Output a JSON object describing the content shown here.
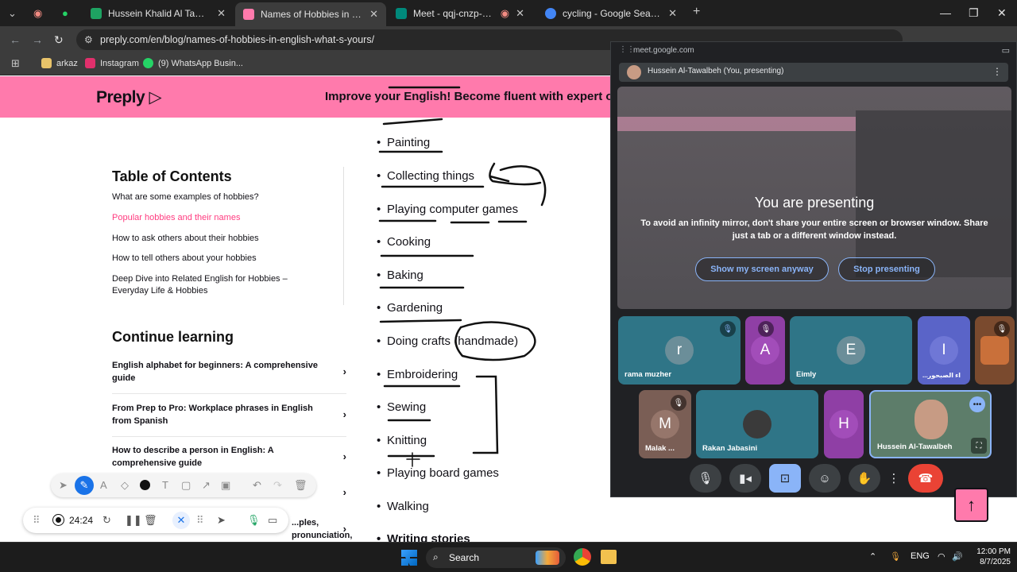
{
  "browser": {
    "tabs": [
      {
        "title": "Hussein Khalid Al Tawalbeh - Gc",
        "color": "#1ea362"
      },
      {
        "title": "Names of Hobbies in English: U",
        "color": "#ff7aac",
        "active": true
      },
      {
        "title": "Meet - qqj-cnzp-pcz",
        "color": "#00897b"
      },
      {
        "title": "cycling - Google Search",
        "color": "#4285f4"
      }
    ],
    "new_tab": "+",
    "url": "preply.com/en/blog/names-of-hobbies-in-english-what-s-yours/",
    "bookmarks": [
      {
        "label": "arkaz",
        "color": "#e8c36a"
      },
      {
        "label": "Instagram",
        "color": "#e1306c"
      },
      {
        "label": "(9) WhatsApp Busin...",
        "color": "#25d366"
      }
    ]
  },
  "page": {
    "logo": "Preply",
    "banner": "Improve your English! Become fluent with expert onli",
    "toc": {
      "title": "Table of Contents",
      "items": [
        "What are some examples of hobbies?",
        "Popular hobbies and their names",
        "How to ask others about their hobbies",
        "How to tell others about your hobbies",
        "Deep Dive into Related English for Hobbies – Everyday Life & Hobbies"
      ]
    },
    "continue": {
      "title": "Continue learning",
      "items": [
        "English alphabet for beginners: A comprehensive guide",
        "From Prep to Pro: Workplace phrases in English from Spanish",
        "How to describe a person in English: A comprehensive guide",
        "",
        "...ples, pronunciation, and tips"
      ]
    },
    "hobbies": [
      "Painting",
      "Collecting things",
      "Playing computer games",
      "Cooking",
      "Baking",
      "Gardening",
      "Doing crafts (handmade)",
      "Embroidering",
      "Sewing",
      "Knitting",
      "Playing board games",
      "Walking",
      "Writing stories"
    ]
  },
  "meet": {
    "url": "meet.google.com",
    "presenter": "Hussein Al-Tawalbeh (You, presenting)",
    "title": "You are presenting",
    "message": "To avoid an infinity mirror, don't share your entire screen or browser window. Share just a tab or a different window instead.",
    "show_anyway": "Show my screen anyway",
    "stop": "Stop presenting",
    "participants": [
      {
        "initial": "r",
        "name": "rama muzher",
        "bg": "#2f7587",
        "avatar": "#6b8e99"
      },
      {
        "initial": "A",
        "name": "",
        "bg": "#8f3fa5",
        "avatar": "#a24db9"
      },
      {
        "initial": "E",
        "name": "Eimly",
        "bg": "#2f7587",
        "avatar": "#6b8e99"
      },
      {
        "initial": "I",
        "name": "...اء الصبحور",
        "bg": "#5a64c8",
        "avatar": "#6f77d6"
      },
      {
        "initial": "",
        "name": "",
        "bg": "#7a4a2e",
        "avatar": "#c9703a"
      },
      {
        "initial": "M",
        "name": "Malak ...",
        "bg": "#7a5e55",
        "avatar": "#96766b"
      },
      {
        "initial": "",
        "name": "Rakan Jabasini",
        "bg": "#2f7587",
        "avatar": "#3a3a3a"
      },
      {
        "initial": "H",
        "name": "",
        "bg": "#8f3fa5",
        "avatar": "#a24db9"
      },
      {
        "initial": "",
        "name": "Hussein Al-Tawalbeh",
        "bg": "#5d7d6a",
        "avatar": "#c79b84"
      }
    ]
  },
  "recorder": {
    "time": "24:24"
  },
  "taskbar": {
    "search": "Search",
    "lang": "ENG",
    "time": "12:00 PM",
    "date": "8/7/2025"
  },
  "colors": {
    "brand_pink": "#ff7aac",
    "accent_pink": "#ff3b7f",
    "meet_blue": "#8ab4f8",
    "end_call": "#ea4335"
  }
}
